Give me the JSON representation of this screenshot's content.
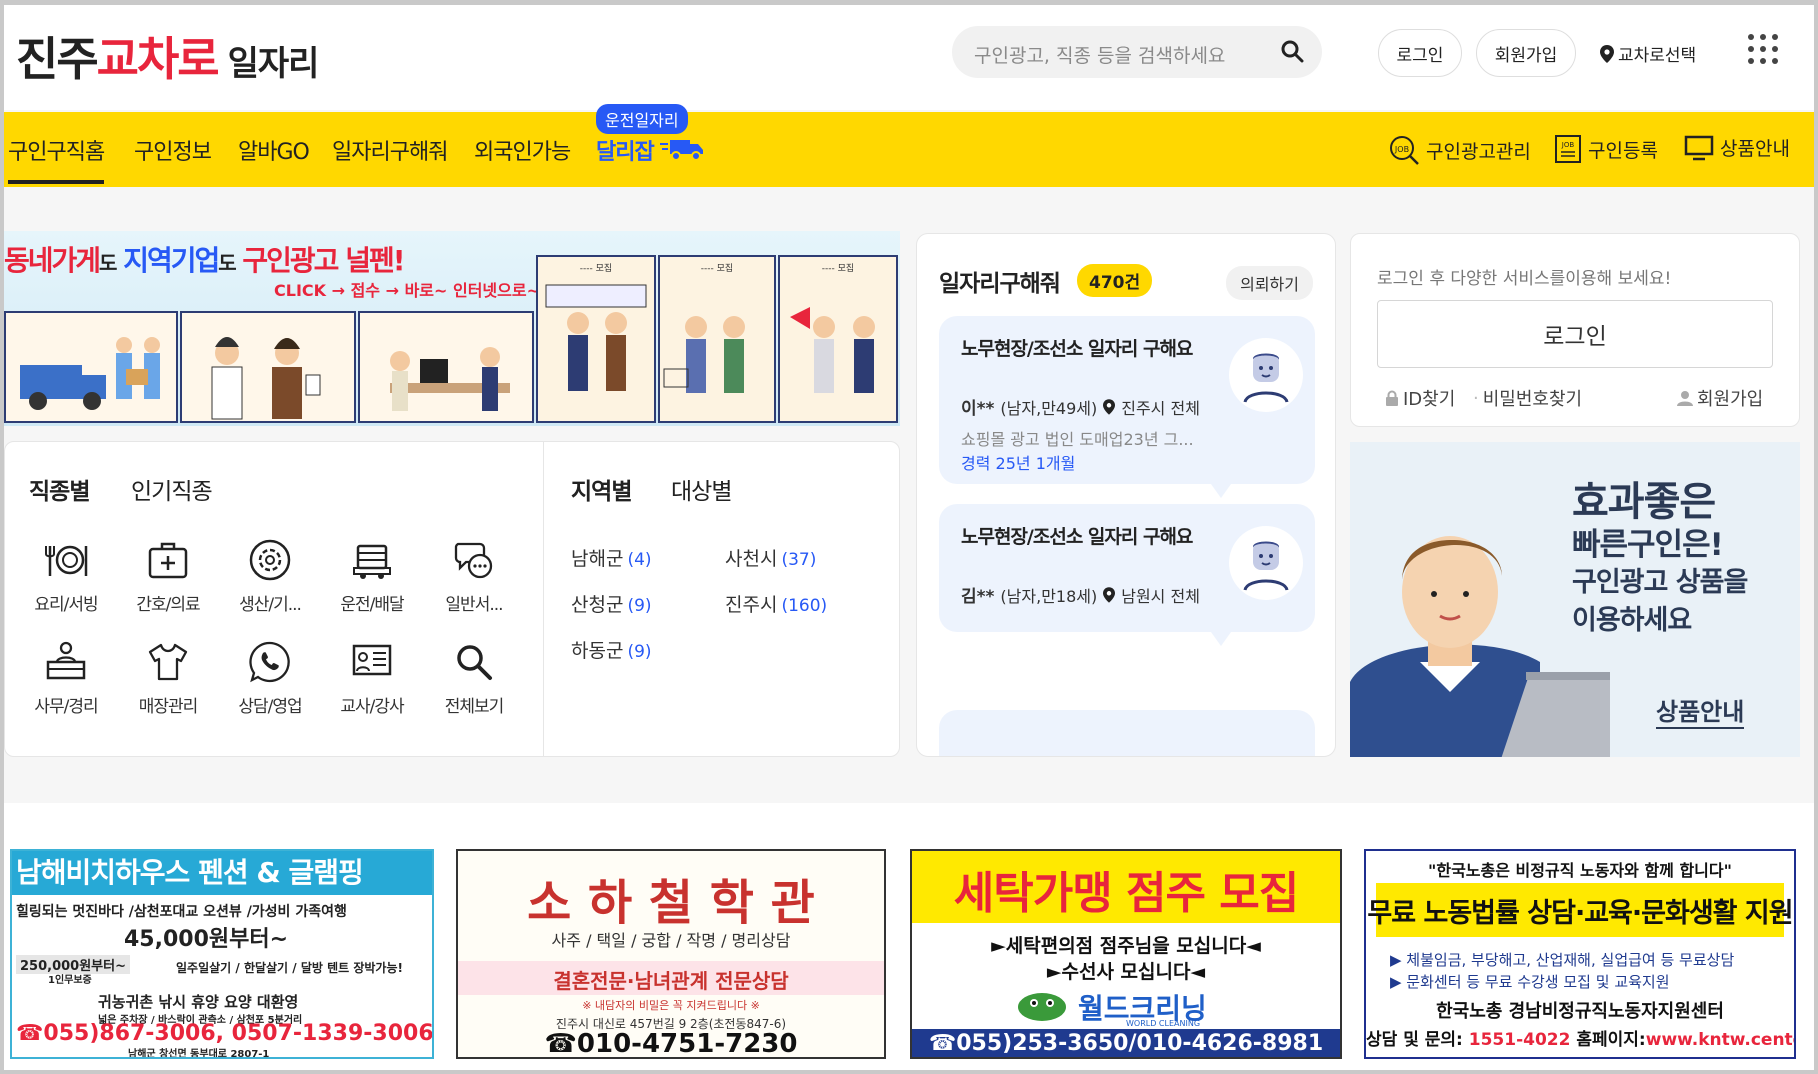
{
  "header": {
    "logo_part1": "진주",
    "logo_part2": "교차로",
    "logo_part3": "일자리",
    "search_placeholder": "구인광고, 직종 등을 검색하세요",
    "login": "로그인",
    "signup": "회원가입",
    "region_select": "교차로선택"
  },
  "nav": {
    "items": [
      "구인구직홈",
      "구인정보",
      "알바GO",
      "일자리구해줘",
      "외국인가능",
      "달리잡"
    ],
    "badge": "운전일자리",
    "right": [
      "구인광고관리",
      "구인등록",
      "상품안내"
    ]
  },
  "banner": {
    "headline_1": "동네가게",
    "headline_2": "도",
    "headline_3": "지역기업",
    "headline_4": "도",
    "headline_5": "구인광고 널펜!",
    "sub": "CLICK → 접수 → 바로~ 인터넷으로~"
  },
  "categories": {
    "tabs_left": [
      "직종별",
      "인기직종"
    ],
    "tabs_right": [
      "지역별",
      "대상별"
    ],
    "items": [
      {
        "label": "요리/서빙",
        "icon": "dining-icon"
      },
      {
        "label": "간호/의료",
        "icon": "medical-kit-icon"
      },
      {
        "label": "생산/기...",
        "icon": "gear-icon"
      },
      {
        "label": "운전/배달",
        "icon": "truck-icon"
      },
      {
        "label": "일반서...",
        "icon": "chat-icon"
      },
      {
        "label": "사무/경리",
        "icon": "desk-icon"
      },
      {
        "label": "매장관리",
        "icon": "shirt-icon"
      },
      {
        "label": "상담/영업",
        "icon": "phone-icon"
      },
      {
        "label": "교사/강사",
        "icon": "board-icon"
      },
      {
        "label": "전체보기",
        "icon": "search-icon"
      }
    ],
    "regions": [
      {
        "name": "남해군",
        "count": "(4)"
      },
      {
        "name": "사천시",
        "count": "(37)"
      },
      {
        "name": "산청군",
        "count": "(9)"
      },
      {
        "name": "진주시",
        "count": "(160)"
      },
      {
        "name": "하동군",
        "count": "(9)"
      }
    ]
  },
  "seekers": {
    "title": "일자리구해줘",
    "count": "470건",
    "request": "의뢰하기",
    "cards": [
      {
        "title": "노무현장/조선소 일자리 구해요",
        "name": "이**",
        "info": "(남자,만49세)",
        "location": "진주시 전체",
        "desc": "쇼핑몰 광고 법인 도매업23년 그...",
        "exp": "경력 25년 1개월"
      },
      {
        "title": "노무현장/조선소 일자리 구해요",
        "name": "김**",
        "info": "(남자,만18세)",
        "location": "남원시 전체",
        "desc": "",
        "exp": ""
      }
    ]
  },
  "login": {
    "hint": "로그인 후 다양한 서비스를이용해 보세요!",
    "button": "로그인",
    "find_id": "ID찾기",
    "find_pw": "비밀번호찾기",
    "signup": "회원가입"
  },
  "promo": {
    "line1": "효과좋은",
    "line2": "빠른구인은!",
    "line3": "구인광고 상품을",
    "line4": "이용하세요",
    "more": "상품안내"
  },
  "ads": {
    "ad1": {
      "title": "남해비치하우스 펜션 & 글램핑",
      "line1": "힐링되는 멋진바다 /삼천포대교 오션뷰 /가성비 가족여행",
      "price": "45,000원부터~",
      "line2a": "250,000원부터~",
      "line2b": "1인무보증",
      "line2c": "일주일살기 / 한달살기 / 달방 텐트 장박가능!",
      "line3": "귀농귀촌 낚시 휴양 요양 대환영",
      "line4": "넓은 주차장 / 바스락이 관측소 / 삼천포 5분거리",
      "phone": "☎055)867-3006, 0507-1339-3006",
      "addr": "남해군 창선면 동부대로 2807-1"
    },
    "ad2": {
      "title": "소 하 철 학 관",
      "line1": "사주 / 택일 / 궁합 / 작명 / 명리상담",
      "line2": "결혼전문·남녀관계 전문상담",
      "line3": "※ 내담자의 비밀은 꼭 지켜드립니다 ※",
      "line4": "진주시 대신로 457번길 9 2층(초전동847-6)",
      "phone": "☎010-4751-7230"
    },
    "ad3": {
      "title": "세탁가맹 점주 모집",
      "line1": "►세탁편의점 점주님을 모십니다◄",
      "line2": "►수선사 모십니다◄",
      "brand": "월드크리닝",
      "brand_sub": "WORLD CLEANING",
      "phone": "☎055)253-3650/010-4626-8981"
    },
    "ad4": {
      "quote": "\"한국노총은 비정규직 노동자와 함께 합니다\"",
      "title": "무료 노동법률 상담·교육·문화생활 지원",
      "line1": "▶ 체불임금, 부당해고, 산업재해, 실업급여 등 무료상담",
      "line2": "▶ 문화센터 등 무료 수강생 모집 및 교육지원",
      "org": "한국노총 경남비정규직노동자지원센터",
      "contact_label": "상담 및 문의:",
      "contact_phone": "1551-4022",
      "contact_web_label": "홈페이지:",
      "contact_web": "www.kntw.center"
    }
  },
  "colors": {
    "brand_red": "#e8253c",
    "nav_yellow": "#ffd800",
    "link_blue": "#2759f5"
  }
}
